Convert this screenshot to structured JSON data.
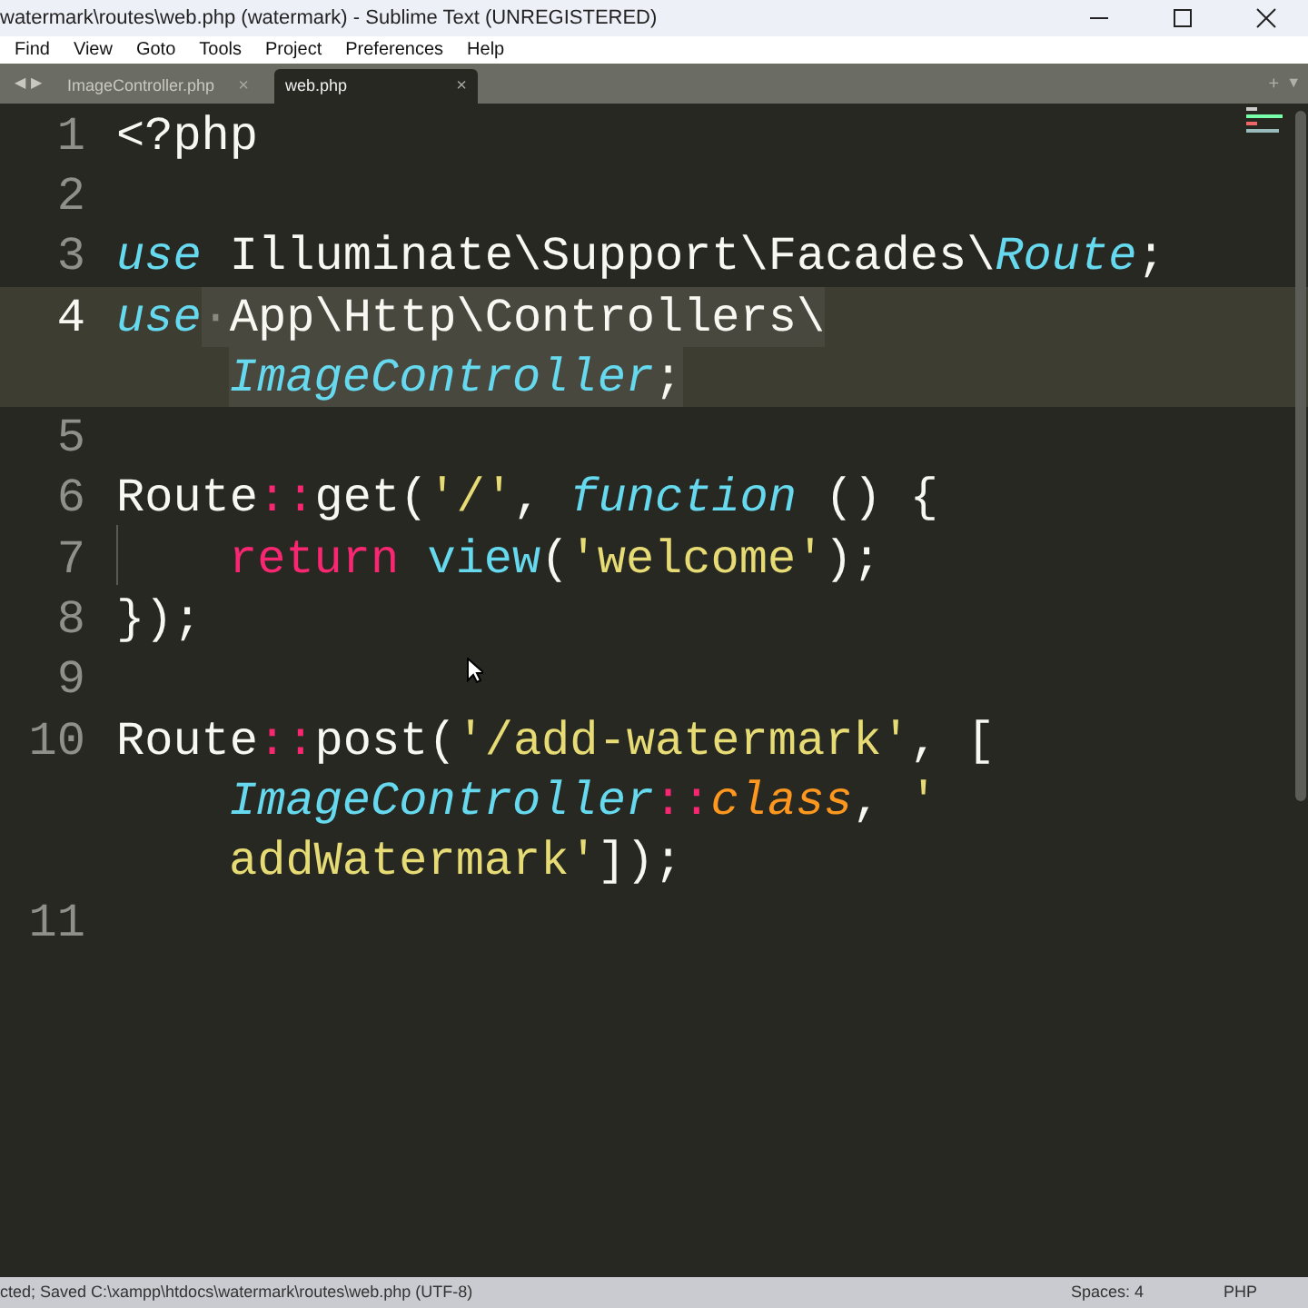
{
  "window": {
    "title": "watermark\\routes\\web.php (watermark) - Sublime Text (UNREGISTERED)"
  },
  "menu": [
    "Find",
    "View",
    "Goto",
    "Tools",
    "Project",
    "Preferences",
    "Help"
  ],
  "tabs": [
    {
      "label": "ImageController.php",
      "selected": false,
      "close": "×"
    },
    {
      "label": "web.php",
      "selected": true,
      "close": "×"
    }
  ],
  "tab_bar_controls": {
    "back": "◀",
    "forward": "▶",
    "add": "+",
    "more": "▼"
  },
  "lines": [
    {
      "number": "1",
      "current": false,
      "rows": [
        {
          "indented": false,
          "tokens": [
            {
              "kind": "plain",
              "text": "<?php",
              "selected": false
            }
          ]
        }
      ]
    },
    {
      "number": "2",
      "current": false
    },
    {
      "number": "3",
      "current": false,
      "rows": [
        {
          "indented": false,
          "tokens": [
            {
              "kind": "keyword",
              "text": "use",
              "selected": false
            },
            {
              "kind": "plain",
              "text": " Illuminate\\Support\\Facades\\",
              "selected": false
            },
            {
              "kind": "class",
              "text": "Route",
              "selected": false
            },
            {
              "kind": "plain",
              "text": ";",
              "selected": false
            }
          ]
        }
      ]
    },
    {
      "number": "4",
      "current": true,
      "rows": [
        {
          "indented": false,
          "tokens": [
            {
              "kind": "keyword",
              "text": "use",
              "selected": false
            },
            {
              "kind": "whitespace",
              "text": "·",
              "selected": true
            },
            {
              "kind": "plain",
              "text": "App\\Http\\Controllers\\",
              "selected": true
            }
          ]
        },
        {
          "indented": true,
          "tokens": [
            {
              "kind": "class",
              "text": "ImageController",
              "selected": true
            },
            {
              "kind": "plain",
              "text": ";",
              "selected": true
            }
          ]
        }
      ]
    },
    {
      "number": "5",
      "current": false
    },
    {
      "number": "6",
      "current": false,
      "rows": [
        {
          "indented": false,
          "tokens": [
            {
              "kind": "plain",
              "text": "Route",
              "selected": false
            },
            {
              "kind": "operator",
              "text": "::",
              "selected": false
            },
            {
              "kind": "plain",
              "text": "get(",
              "selected": false
            },
            {
              "kind": "string",
              "text": "'/'",
              "selected": false
            },
            {
              "kind": "plain",
              "text": ", ",
              "selected": false
            },
            {
              "kind": "keyword",
              "text": "function",
              "selected": false
            },
            {
              "kind": "plain",
              "text": " () {",
              "selected": false
            }
          ]
        }
      ]
    },
    {
      "number": "7",
      "current": false,
      "rows": [
        {
          "indented": true,
          "tokens": [
            {
              "kind": "control",
              "text": "return",
              "selected": false
            },
            {
              "kind": "function",
              "text": " view",
              "selected": false
            },
            {
              "kind": "plain",
              "text": "(",
              "selected": false
            },
            {
              "kind": "string",
              "text": "'welcome'",
              "selected": false
            },
            {
              "kind": "plain",
              "text": ");",
              "selected": false
            }
          ]
        }
      ]
    },
    {
      "number": "8",
      "current": false,
      "rows": [
        {
          "indented": false,
          "tokens": [
            {
              "kind": "plain",
              "text": "});",
              "selected": false
            }
          ]
        }
      ]
    },
    {
      "number": "9",
      "current": false
    },
    {
      "number": "10",
      "current": false,
      "rows": [
        {
          "indented": false,
          "tokens": [
            {
              "kind": "plain",
              "text": "Route",
              "selected": false
            },
            {
              "kind": "operator",
              "text": "::",
              "selected": false
            },
            {
              "kind": "plain",
              "text": "post(",
              "selected": false
            },
            {
              "kind": "string",
              "text": "'/add-watermark'",
              "selected": false
            },
            {
              "kind": "plain",
              "text": ", [",
              "selected": false
            }
          ]
        },
        {
          "indented": true,
          "tokens": [
            {
              "kind": "class",
              "text": "ImageController",
              "selected": false
            },
            {
              "kind": "operator",
              "text": "::",
              "selected": false
            },
            {
              "kind": "constant",
              "text": "class",
              "selected": false
            },
            {
              "kind": "plain",
              "text": ", ",
              "selected": false
            },
            {
              "kind": "string",
              "text": "'",
              "selected": false
            }
          ]
        },
        {
          "indented": true,
          "tokens": [
            {
              "kind": "string",
              "text": "addWatermark'",
              "selected": false
            },
            {
              "kind": "plain",
              "text": "]);",
              "selected": false
            }
          ]
        }
      ]
    },
    {
      "number": "11",
      "current": false
    }
  ],
  "status_bar": {
    "message": "cted; Saved C:\\xampp\\htdocs\\watermark\\routes\\web.php (UTF-8)",
    "indentation": "Spaces: 4",
    "syntax": "PHP"
  }
}
